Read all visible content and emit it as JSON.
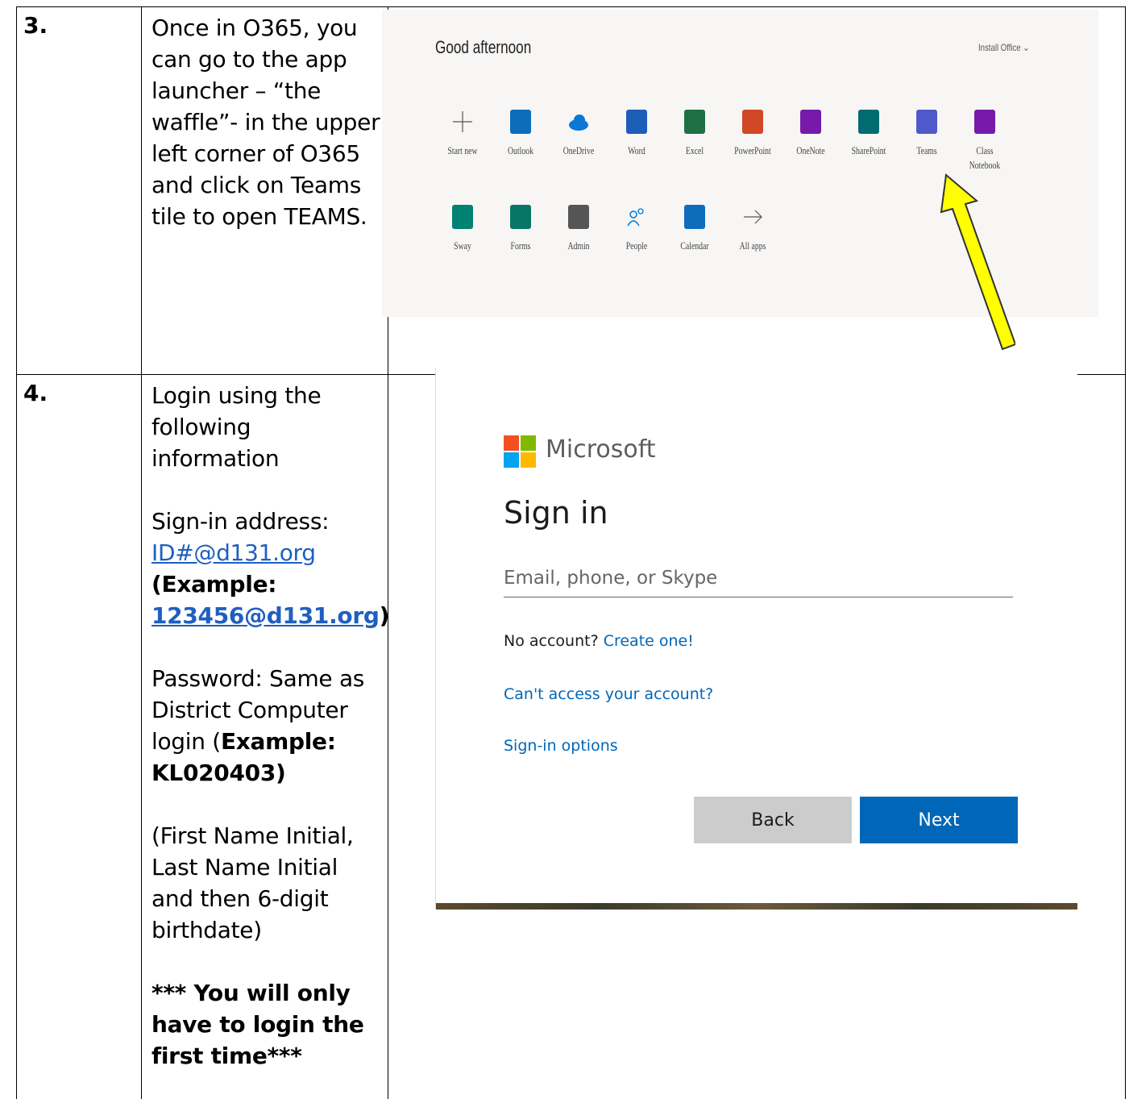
{
  "step3": {
    "number": "3.",
    "text": "Once in O365, you can go to the app launcher – “the waffle”- in the upper left corner of O365 and click on Teams tile to open TEAMS."
  },
  "o365": {
    "greeting": "Good afternoon",
    "install": "Install Office",
    "apps_row1": [
      {
        "label": "Start new",
        "color": "#ffffff",
        "icon": "plus-icon"
      },
      {
        "label": "Outlook",
        "color": "#0f6cbd",
        "icon": "outlook-icon"
      },
      {
        "label": "OneDrive",
        "color": "#0a78d4",
        "icon": "onedrive-icon"
      },
      {
        "label": "Word",
        "color": "#1c5db8",
        "icon": "word-icon"
      },
      {
        "label": "Excel",
        "color": "#1e7145",
        "icon": "excel-icon"
      },
      {
        "label": "PowerPoint",
        "color": "#d24726",
        "icon": "powerpoint-icon"
      },
      {
        "label": "OneNote",
        "color": "#7719aa",
        "icon": "onenote-icon"
      },
      {
        "label": "SharePoint",
        "color": "#036c70",
        "icon": "sharepoint-icon"
      },
      {
        "label": "Teams",
        "color": "#5059c9",
        "icon": "teams-icon"
      },
      {
        "label": "Class Notebook",
        "color": "#7719aa",
        "icon": "class-notebook-icon"
      }
    ],
    "apps_row2": [
      {
        "label": "Sway",
        "color": "#008272",
        "icon": "sway-icon"
      },
      {
        "label": "Forms",
        "color": "#077568",
        "icon": "forms-icon"
      },
      {
        "label": "Admin",
        "color": "#555555",
        "icon": "admin-icon"
      },
      {
        "label": "People",
        "color": "#0078d4",
        "icon": "people-icon"
      },
      {
        "label": "Calendar",
        "color": "#0f6cbd",
        "icon": "calendar-icon"
      },
      {
        "label": "All apps",
        "color": "#444444",
        "icon": "arrow-right-icon"
      }
    ],
    "arrow_color": "#ffff00"
  },
  "step4": {
    "number": "4.",
    "intro": "Login using the following information",
    "signin_label": "Sign-in address:",
    "signin_link": "ID#@d131.org",
    "example_prefix": "(Example:",
    "example_link": "123456@d131.org",
    "example_suffix": ")",
    "password_text": "Password: Same as District Computer login (",
    "password_example": "Example: KL020403)",
    "format_note": "(First Name Initial, Last Name Initial and then 6-digit birthdate)",
    "only_once": "*** You will only have to login the first time***"
  },
  "signin": {
    "brand": "Microsoft",
    "title": "Sign in",
    "placeholder": "Email, phone, or Skype",
    "no_account": "No account?",
    "create": "Create one!",
    "cant_access": "Can't access your account?",
    "options": "Sign-in options",
    "back": "Back",
    "next": "Next",
    "logo_colors": [
      "#f25022",
      "#7fba00",
      "#00a4ef",
      "#ffb900"
    ]
  }
}
